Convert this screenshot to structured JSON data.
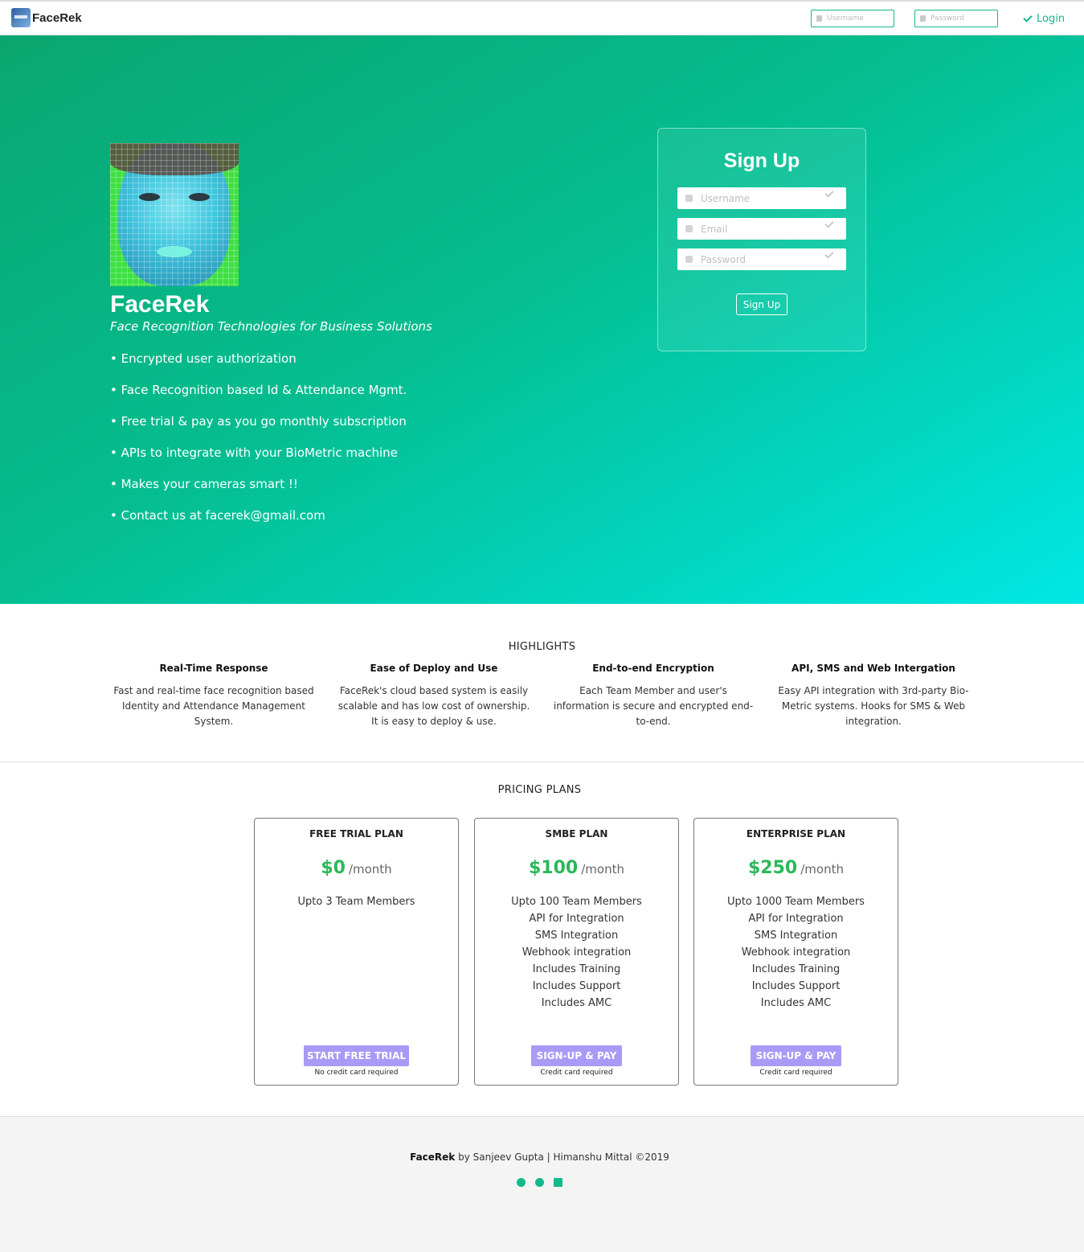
{
  "nav": {
    "brand": "FaceRek",
    "username_placeholder": "Username",
    "password_placeholder": "Password",
    "login_label": "Login"
  },
  "hero": {
    "title": "FaceRek",
    "subtitle": "Face Recognition Technologies for Business Solutions",
    "features": [
      "• Encrypted user authorization",
      "• Face Recognition based Id & Attendance Mgmt.",
      "• Free trial & pay as you go monthly subscription",
      "• APIs to integrate with your BioMetric machine",
      "• Makes your cameras smart !!",
      "• Contact us at facerek@gmail.com"
    ]
  },
  "signup": {
    "title": "Sign Up",
    "username_placeholder": "Username",
    "email_placeholder": "Email",
    "password_placeholder": "Password",
    "button": "Sign Up"
  },
  "highlights": {
    "title": "HIGHLIGHTS",
    "items": [
      {
        "title": "Real-Time Response",
        "text": "Fast and real-time face recognition based Identity and Attendance Management System."
      },
      {
        "title": "Ease of Deploy and Use",
        "text": "FaceRek's cloud based system is easily scalable and has low cost of ownership. It is easy to deploy & use."
      },
      {
        "title": "End-to-end Encryption",
        "text": "Each Team Member and user's information is secure and encrypted end-to-end."
      },
      {
        "title": "API, SMS and Web Intergation",
        "text": "Easy API integration with 3rd-party Bio-Metric systems. Hooks for SMS & Web integration."
      }
    ]
  },
  "pricing": {
    "title": "PRICING PLANS",
    "plans": [
      {
        "name": "FREE TRIAL PLAN",
        "price": "$0",
        "period": "/month",
        "features": [
          "Upto 3 Team Members"
        ],
        "cta": "START FREE TRIAL",
        "note": "No credit card required"
      },
      {
        "name": "SMBE PLAN",
        "price": "$100",
        "period": "/month",
        "features": [
          "Upto 100 Team Members",
          "API for Integration",
          "SMS Integration",
          "Webhook integration",
          "Includes Training",
          "Includes Support",
          "Includes AMC"
        ],
        "cta": "SIGN-UP & PAY",
        "note": "Credit card required"
      },
      {
        "name": "ENTERPRISE PLAN",
        "price": "$250",
        "period": "/month",
        "features": [
          "Upto 1000 Team Members",
          "API for Integration",
          "SMS Integration",
          "Webhook integration",
          "Includes Training",
          "Includes Support",
          "Includes AMC"
        ],
        "cta": "SIGN-UP & PAY",
        "note": "Credit card required"
      }
    ]
  },
  "footer": {
    "brand": "FaceRek",
    "text": " by Sanjeev Gupta | Himanshu Mittal ©2019",
    "icons": [
      "globe-icon",
      "github-icon",
      "envelope-icon"
    ]
  },
  "colors": {
    "accent": "#12b98c",
    "price_green": "#2bb859",
    "cta_purple": "#a99af7"
  }
}
